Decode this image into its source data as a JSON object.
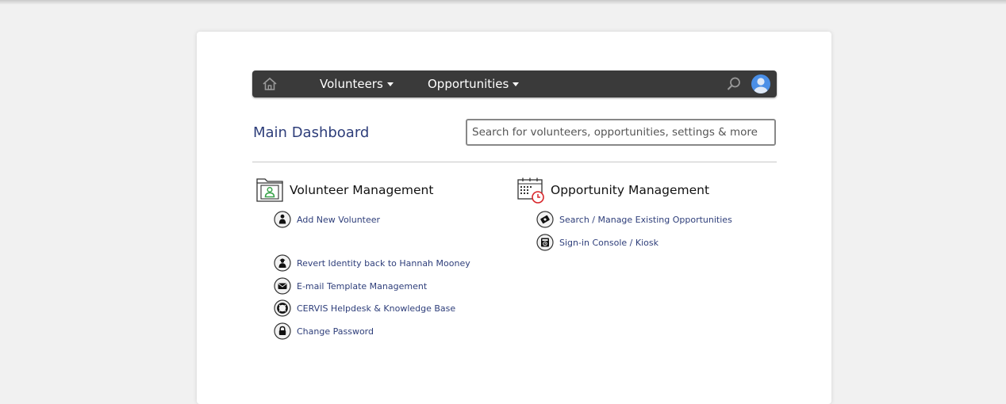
{
  "nav": {
    "menus": [
      {
        "label": "Volunteers"
      },
      {
        "label": "Opportunities"
      }
    ]
  },
  "page": {
    "title": "Main Dashboard",
    "search_placeholder": "Search for volunteers, opportunities, settings & more"
  },
  "volunteer_management": {
    "title": "Volunteer Management",
    "links": [
      {
        "label": "Add New Volunteer",
        "icon": "person-icon"
      },
      {
        "label": "Revert Identity back to Hannah Mooney",
        "icon": "identity-icon"
      },
      {
        "label": "E-mail Template Management",
        "icon": "envelope-icon"
      },
      {
        "label": "CERVIS Helpdesk & Knowledge Base",
        "icon": "lifebuoy-icon"
      },
      {
        "label": "Change Password",
        "icon": "lock-icon"
      }
    ]
  },
  "opportunity_management": {
    "title": "Opportunity Management",
    "links": [
      {
        "label": "Search / Manage Existing Opportunities",
        "icon": "ticket-icon"
      },
      {
        "label": "Sign-in Console / Kiosk",
        "icon": "kiosk-icon"
      }
    ]
  },
  "colors": {
    "navbar": "#3a3a3a",
    "link_text": "#2e3e7a",
    "avatar": "#4a8fe7",
    "volunteer_icon": "#3aa34a",
    "calendar_clock": "#d9262b"
  }
}
